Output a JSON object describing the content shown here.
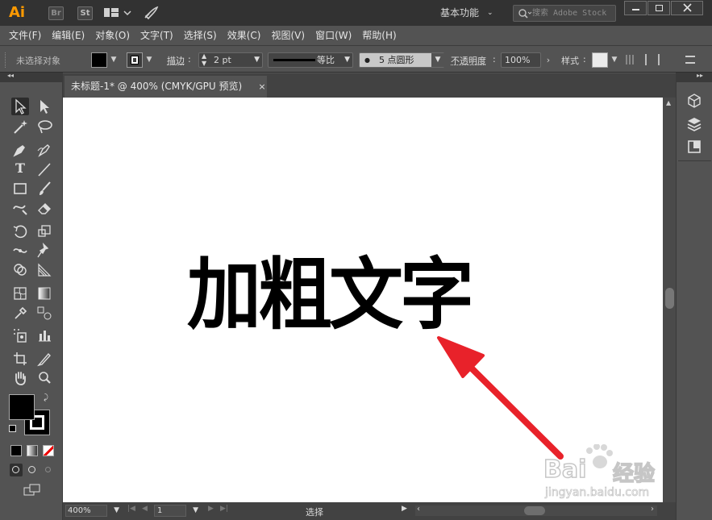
{
  "app": {
    "logo": "Ai",
    "bridge_label": "Br",
    "stock_label": "St",
    "workspace": "基本功能",
    "search_placeholder": "搜索 Adobe Stock"
  },
  "menu": [
    "文件(F)",
    "编辑(E)",
    "对象(O)",
    "文字(T)",
    "选择(S)",
    "效果(C)",
    "视图(V)",
    "窗口(W)",
    "帮助(H)"
  ],
  "control": {
    "selection_status": "未选择对象",
    "stroke_label": "描边",
    "stroke_weight": "2 pt",
    "stroke_profile": "等比",
    "brush_dot": "●",
    "brush": "5 点圆形",
    "opacity_label": "不透明度",
    "opacity_value": "100%",
    "style_label": "样式",
    "fill_color": "#000000",
    "stroke_color": "#ffffff"
  },
  "document": {
    "tab_title": "未标题-1* @ 400% (CMYK/GPU 预览)",
    "close": "×",
    "canvas_text": "加粗文字",
    "watermark_line1": "Bai",
    "watermark_line2": "经验",
    "watermark_url": "jingyan.baidu.com"
  },
  "status": {
    "zoom": "400%",
    "page": "1",
    "tool_status": "选择"
  },
  "colors": {
    "arrow": "#e8222a",
    "canvas": "#ffffff",
    "text": "#000000",
    "ai_orange": "#ff9a00"
  }
}
